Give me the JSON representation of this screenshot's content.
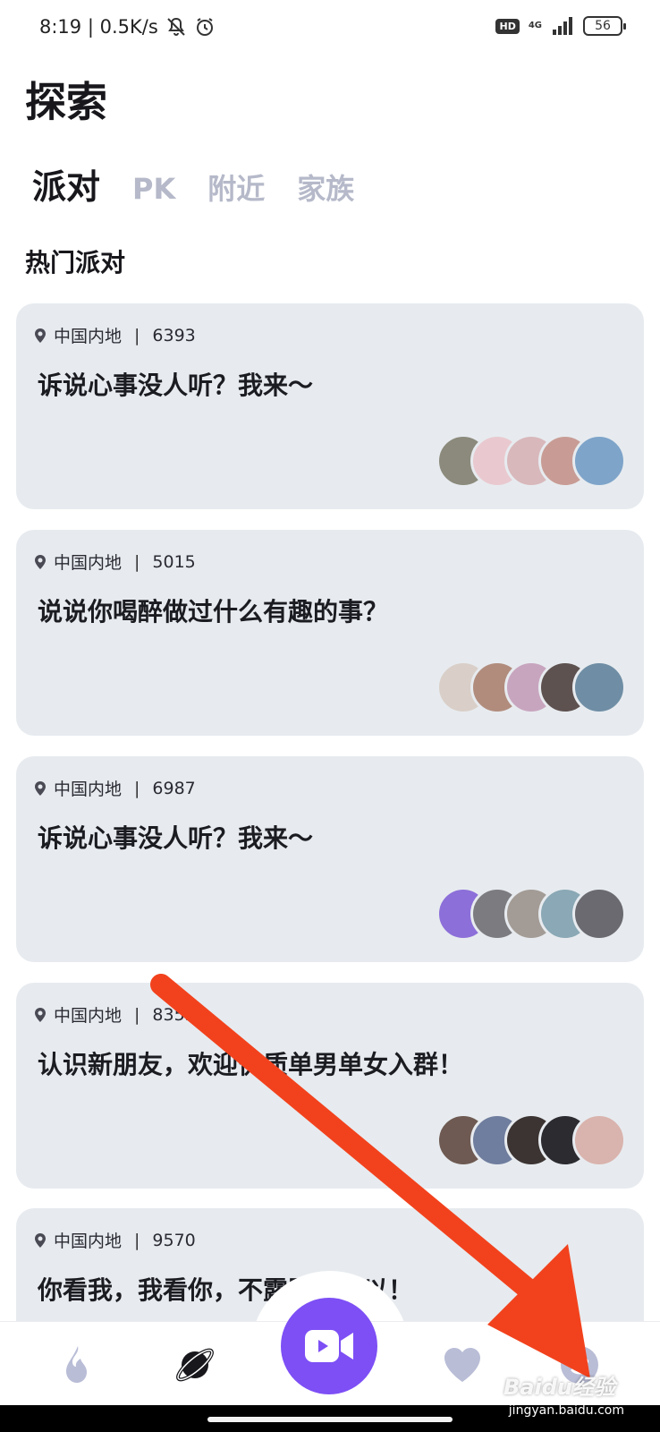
{
  "status_bar": {
    "time_speed": "8:19 | 0.5K/s",
    "hd": "HD",
    "network": "4G",
    "battery": "56"
  },
  "header": {
    "title": "探索",
    "tabs": [
      "派对",
      "PK",
      "附近",
      "家族"
    ],
    "active_tab": "派对",
    "section_title": "热门派对"
  },
  "cards": [
    {
      "location": "中国内地",
      "count": "6393",
      "title": "诉说心事没人听？我来～",
      "avatar_colors": [
        "#8b8a7c",
        "#e9c9cf",
        "#d8b8bb",
        "#c89c95",
        "#7ea4c9"
      ]
    },
    {
      "location": "中国内地",
      "count": "5015",
      "title": "说说你喝醉做过什么有趣的事？",
      "avatar_colors": [
        "#d9cfc8",
        "#b18c7d",
        "#c8a5bf",
        "#5e5250",
        "#6f8ea5"
      ]
    },
    {
      "location": "中国内地",
      "count": "6987",
      "title": "诉说心事没人听？我来～",
      "avatar_colors": [
        "#8c6fd9",
        "#7c7c80",
        "#a39b95",
        "#8aa8b5",
        "#6a6a70"
      ]
    },
    {
      "location": "中国内地",
      "count": "8353",
      "title": "认识新朋友，欢迎优质单男单女入群！",
      "avatar_colors": [
        "#6e5a52",
        "#6f7d9e",
        "#3c3432",
        "#2b2b30",
        "#d9b3ad"
      ]
    },
    {
      "location": "中国内地",
      "count": "9570",
      "title": "你看我，我看你，不露脸也可以！",
      "avatar_colors": []
    }
  ],
  "bottom_nav": {
    "items": [
      "flame-icon",
      "planet-icon",
      "video-camera-icon",
      "heart-icon",
      "face-icon"
    ],
    "accent": "#7d4ff5",
    "inactive": "#b9bdd6"
  },
  "watermark": {
    "brand": "Baidu经验",
    "url": "jingyan.baidu.com"
  }
}
